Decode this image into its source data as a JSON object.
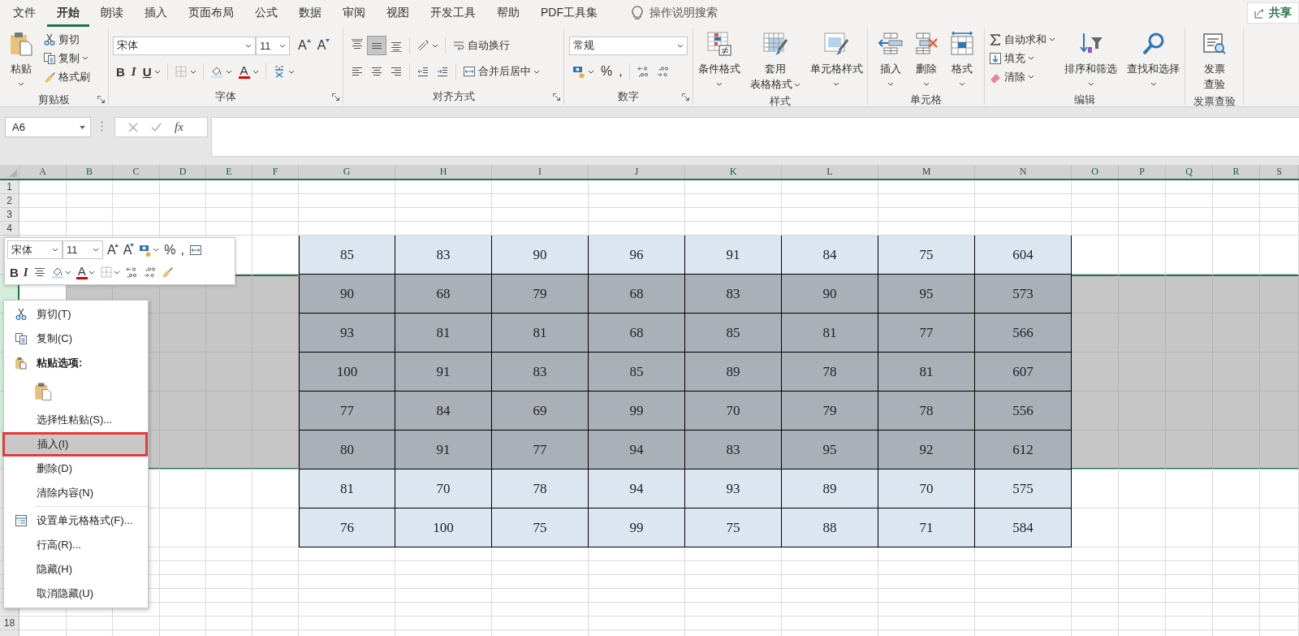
{
  "menu_tabs": [
    {
      "label": "文件",
      "selected": false
    },
    {
      "label": "开始",
      "selected": true
    },
    {
      "label": "朗读",
      "selected": false
    },
    {
      "label": "插入",
      "selected": false
    },
    {
      "label": "页面布局",
      "selected": false
    },
    {
      "label": "公式",
      "selected": false
    },
    {
      "label": "数据",
      "selected": false
    },
    {
      "label": "审阅",
      "selected": false
    },
    {
      "label": "视图",
      "selected": false
    },
    {
      "label": "开发工具",
      "selected": false
    },
    {
      "label": "帮助",
      "selected": false
    },
    {
      "label": "PDF工具集",
      "selected": false
    }
  ],
  "tell_me": "操作说明搜索",
  "share": "共享",
  "ribbon": [
    {
      "label": "剪贴板",
      "launcher": true,
      "parts": [
        {
          "kind": "large",
          "lines": [
            "粘贴"
          ],
          "dropdown": true
        },
        {
          "kind": "stack",
          "rows": [
            {
              "tools": [
                {
                  "kind": "small",
                  "label": "剪切",
                  "dropdown": false
                }
              ]
            },
            {
              "tools": [
                {
                  "kind": "small",
                  "label": "复制",
                  "dropdown": true
                }
              ]
            },
            {
              "tools": [
                {
                  "kind": "small",
                  "label": "格式刷",
                  "dropdown": false
                }
              ]
            }
          ]
        }
      ]
    },
    {
      "label": "字体",
      "launcher": true,
      "parts": [
        {
          "kind": "stack",
          "rows": [
            {
              "tools": [
                {
                  "kind": "fontbox",
                  "value": "宋体"
                },
                {
                  "kind": "sizebox",
                  "value": "11"
                },
                {
                  "kind": "grow",
                  "glyph": "A",
                  "dropdown": false
                },
                {
                  "kind": "shrink",
                  "glyph": "A",
                  "dropdown": false
                }
              ]
            },
            {
              "tools": [
                {
                  "kind": "bold",
                  "glyph": "B",
                  "dropdown": false
                },
                {
                  "kind": "italic",
                  "glyph": "I",
                  "dropdown": false
                },
                {
                  "kind": "underline",
                  "glyph": "U",
                  "dropdown": true
                },
                {
                  "kind": "sep"
                },
                {
                  "kind": "icon",
                  "dropdown": true
                },
                {
                  "kind": "sep"
                },
                {
                  "kind": "icon",
                  "dropdown": true
                },
                {
                  "kind": "fontcolor",
                  "glyph": "A",
                  "dropdown": true
                },
                {
                  "kind": "sep"
                },
                {
                  "kind": "icon",
                  "dropdown": true
                }
              ]
            }
          ]
        }
      ]
    },
    {
      "label": "对齐方式",
      "launcher": true,
      "parts": [
        {
          "kind": "stack",
          "rows": [
            {
              "tools": [
                {
                  "kind": "icon",
                  "dropdown": false,
                  "selected": false
                },
                {
                  "kind": "icon",
                  "dropdown": false,
                  "selected": true
                },
                {
                  "kind": "icon",
                  "dropdown": false,
                  "selected": false
                },
                {
                  "kind": "sep"
                },
                {
                  "kind": "icon",
                  "dropdown": true
                },
                {
                  "kind": "sep"
                },
                {
                  "kind": "small",
                  "label": "自动换行",
                  "dropdown": false
                }
              ]
            },
            {
              "tools": [
                {
                  "kind": "icon",
                  "dropdown": false,
                  "selected": false
                },
                {
                  "kind": "icon",
                  "dropdown": false,
                  "selected": false
                },
                {
                  "kind": "icon",
                  "dropdown": false,
                  "selected": false
                },
                {
                  "kind": "sep"
                },
                {
                  "kind": "icon",
                  "dropdown": false
                },
                {
                  "kind": "icon",
                  "dropdown": false
                },
                {
                  "kind": "sep"
                },
                {
                  "kind": "small",
                  "label": "合并后居中",
                  "dropdown": true
                }
              ]
            }
          ]
        }
      ]
    },
    {
      "label": "数字",
      "launcher": true,
      "parts": [
        {
          "kind": "stack",
          "rows": [
            {
              "tools": [
                {
                  "kind": "formatbox",
                  "value": "常规"
                }
              ]
            },
            {
              "tools": [
                {
                  "kind": "icon",
                  "dropdown": true
                },
                {
                  "kind": "symbol",
                  "glyph": "%",
                  "dropdown": false
                },
                {
                  "kind": "symbol",
                  "glyph": ",",
                  "dropdown": false
                },
                {
                  "kind": "sep"
                },
                {
                  "kind": "icon",
                  "dropdown": false
                },
                {
                  "kind": "icon",
                  "dropdown": false
                }
              ]
            }
          ]
        }
      ]
    },
    {
      "label": "样式",
      "launcher": false,
      "parts": [
        {
          "kind": "large",
          "lines": [
            "条件格式"
          ],
          "dropdown": true
        },
        {
          "kind": "large",
          "lines": [
            "套用",
            "表格格式"
          ],
          "dropdown": true
        },
        {
          "kind": "large",
          "lines": [
            "单元格样式"
          ],
          "dropdown": true
        }
      ]
    },
    {
      "label": "单元格",
      "launcher": false,
      "parts": [
        {
          "kind": "large",
          "lines": [
            "插入"
          ],
          "dropdown": true
        },
        {
          "kind": "large",
          "lines": [
            "删除"
          ],
          "dropdown": true
        },
        {
          "kind": "large",
          "lines": [
            "格式"
          ],
          "dropdown": true
        }
      ]
    },
    {
      "label": "编辑",
      "launcher": false,
      "parts": [
        {
          "kind": "stack",
          "rows": [
            {
              "tools": [
                {
                  "kind": "small",
                  "label": "自动求和",
                  "dropdown": true
                }
              ]
            },
            {
              "tools": [
                {
                  "kind": "small",
                  "label": "填充",
                  "dropdown": true
                }
              ]
            },
            {
              "tools": [
                {
                  "kind": "small",
                  "label": "清除",
                  "dropdown": true
                }
              ]
            }
          ]
        },
        {
          "kind": "large",
          "lines": [
            "排序和筛选"
          ],
          "dropdown": true
        },
        {
          "kind": "large",
          "lines": [
            "查找和选择"
          ],
          "dropdown": true
        }
      ]
    },
    {
      "label": "发票查验",
      "launcher": false,
      "parts": [
        {
          "kind": "large",
          "lines": [
            "发票",
            "查验"
          ],
          "dropdown": false
        }
      ]
    }
  ],
  "name_box": "A6",
  "function_label": "fx",
  "sheet": {
    "columns": [
      "A",
      "B",
      "C",
      "D",
      "E",
      "F",
      "G",
      "H",
      "I",
      "J",
      "K",
      "L",
      "M",
      "N",
      "O",
      "P",
      "Q",
      "R",
      "S"
    ],
    "rows": [
      {
        "header": "1",
        "selected": false
      },
      {
        "header": "2",
        "selected": false
      },
      {
        "header": "3",
        "selected": false
      },
      {
        "header": "4",
        "selected": false
      },
      {
        "selected": false,
        "cells": [
          "85",
          "83",
          "90",
          "96",
          "91",
          "84",
          "75",
          "604"
        ]
      },
      {
        "selected": true,
        "active": true,
        "cells": [
          "90",
          "68",
          "79",
          "68",
          "83",
          "90",
          "95",
          "573"
        ]
      },
      {
        "selected": true,
        "cells": [
          "93",
          "81",
          "81",
          "68",
          "85",
          "81",
          "77",
          "566"
        ]
      },
      {
        "selected": true,
        "cells": [
          "100",
          "91",
          "83",
          "85",
          "89",
          "78",
          "81",
          "607"
        ]
      },
      {
        "selected": true,
        "cells": [
          "77",
          "84",
          "69",
          "99",
          "70",
          "79",
          "78",
          "556"
        ]
      },
      {
        "selected": true,
        "cells": [
          "80",
          "91",
          "77",
          "94",
          "83",
          "95",
          "92",
          "612"
        ]
      },
      {
        "selected": false,
        "cells": [
          "81",
          "70",
          "78",
          "94",
          "93",
          "89",
          "70",
          "575"
        ]
      },
      {
        "selected": false,
        "cells": [
          "76",
          "100",
          "75",
          "99",
          "75",
          "88",
          "71",
          "584"
        ]
      },
      {
        "selected": false
      },
      {
        "selected": false
      },
      {
        "selected": false
      },
      {
        "selected": false
      },
      {
        "selected": false
      },
      {
        "header": "18",
        "selected": false
      },
      {
        "selected": false
      }
    ]
  },
  "mini_toolbar": {
    "rows": [
      {
        "tools": [
          {
            "kind": "fontbox",
            "value": "宋体"
          },
          {
            "kind": "sizebox",
            "value": "11"
          },
          {
            "kind": "grow",
            "glyph": "A",
            "dropdown": false
          },
          {
            "kind": "shrink",
            "glyph": "A",
            "dropdown": false
          },
          {
            "kind": "icon",
            "dropdown": true
          },
          {
            "kind": "symbol",
            "glyph": "%",
            "dropdown": false
          },
          {
            "kind": "symbol",
            "glyph": ",",
            "dropdown": false
          },
          {
            "kind": "icon",
            "dropdown": false
          }
        ]
      },
      {
        "tools": [
          {
            "kind": "bold",
            "glyph": "B",
            "dropdown": false
          },
          {
            "kind": "italic",
            "glyph": "I",
            "dropdown": false
          },
          {
            "kind": "icon",
            "dropdown": false
          },
          {
            "kind": "icon",
            "dropdown": true
          },
          {
            "kind": "fontcolor",
            "glyph": "A",
            "dropdown": true
          },
          {
            "kind": "icon",
            "dropdown": true
          },
          {
            "kind": "icon",
            "dropdown": false
          },
          {
            "kind": "icon",
            "dropdown": false
          },
          {
            "kind": "icon",
            "dropdown": false
          }
        ]
      }
    ]
  },
  "context_menu": [
    {
      "kind": "iconitem",
      "label": "剪切(T)",
      "selected": false,
      "outlined": false
    },
    {
      "kind": "iconitem",
      "label": "复制(C)",
      "selected": false,
      "outlined": false
    },
    {
      "kind": "header",
      "label": "粘贴选项:"
    },
    {
      "kind": "pasteoptions"
    },
    {
      "kind": "item",
      "label": "选择性粘贴(S)...",
      "selected": false,
      "outlined": false
    },
    {
      "kind": "item",
      "label": "插入(I)",
      "selected": true,
      "outlined": true
    },
    {
      "kind": "item",
      "label": "删除(D)",
      "selected": false,
      "outlined": false
    },
    {
      "kind": "item",
      "label": "清除内容(N)",
      "selected": false,
      "outlined": false
    },
    {
      "kind": "separator"
    },
    {
      "kind": "iconitem",
      "label": "设置单元格格式(F)...",
      "selected": false,
      "outlined": false
    },
    {
      "kind": "item",
      "label": "行高(R)...",
      "selected": false,
      "outlined": false
    },
    {
      "kind": "item",
      "label": "隐藏(H)",
      "selected": false,
      "outlined": false
    },
    {
      "kind": "item",
      "label": "取消隐藏(U)",
      "selected": false,
      "outlined": false
    }
  ]
}
